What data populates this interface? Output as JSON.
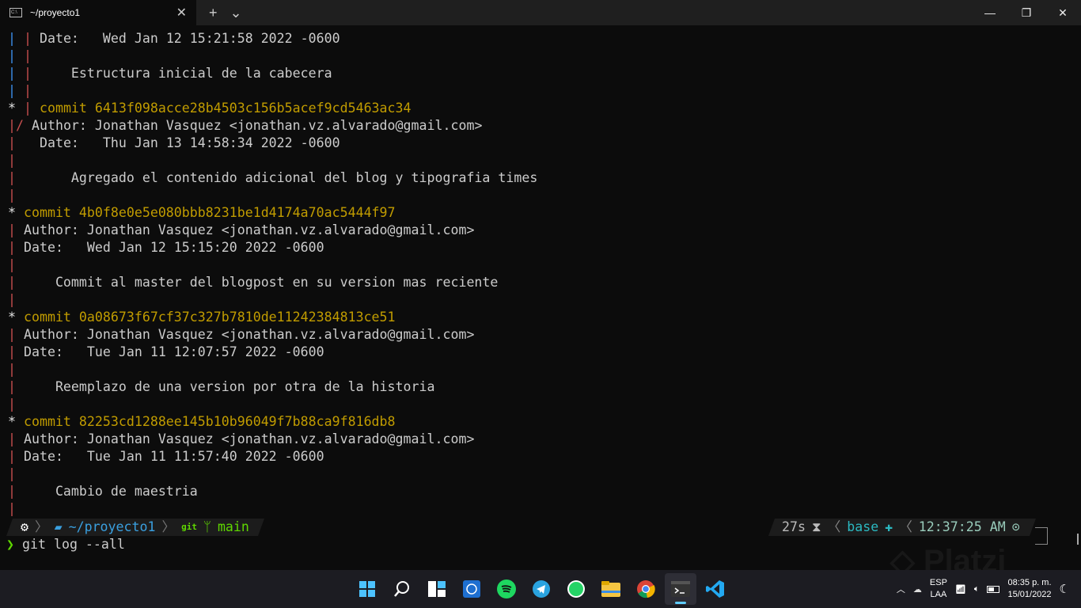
{
  "window": {
    "tab_title": "~/proyecto1",
    "new_tab": "+",
    "dropdown": "⌄",
    "minimize": "—",
    "maximize": "❐",
    "close": "✕",
    "tab_close": "✕"
  },
  "colors": {
    "blue": "#3b8eea",
    "red": "#c74e4e",
    "yellow": "#c19c00",
    "prompt_path": "#3aa0e0",
    "git": "#5fd700",
    "base": "#2bb8c0"
  },
  "terminal": {
    "rows": [
      [
        {
          "t": "| ",
          "c": "blue"
        },
        {
          "t": "| ",
          "c": "red"
        },
        {
          "t": "Date:   Wed Jan 12 15:21:58 2022 -0600",
          "c": "text"
        }
      ],
      [
        {
          "t": "| ",
          "c": "blue"
        },
        {
          "t": "|",
          "c": "red"
        }
      ],
      [
        {
          "t": "| ",
          "c": "blue"
        },
        {
          "t": "| ",
          "c": "red"
        },
        {
          "t": "    Estructura inicial de la cabecera",
          "c": "text"
        }
      ],
      [
        {
          "t": "| ",
          "c": "blue"
        },
        {
          "t": "|",
          "c": "red"
        }
      ],
      [
        {
          "t": "* ",
          "c": "white"
        },
        {
          "t": "| ",
          "c": "red"
        },
        {
          "t": "commit 6413f098acce28b4503c156b5acef9cd5463ac34",
          "c": "yellow"
        }
      ],
      [
        {
          "t": "|/ ",
          "c": "red"
        },
        {
          "t": "Author: Jonathan Vasquez <jonathan.vz.alvarado@gmail.com>",
          "c": "text"
        }
      ],
      [
        {
          "t": "|   ",
          "c": "red"
        },
        {
          "t": "Date:   Thu Jan 13 14:58:34 2022 -0600",
          "c": "text"
        }
      ],
      [
        {
          "t": "|",
          "c": "red"
        }
      ],
      [
        {
          "t": "|   ",
          "c": "red"
        },
        {
          "t": "    Agregado el contenido adicional del blog y tipografia times",
          "c": "text"
        }
      ],
      [
        {
          "t": "|",
          "c": "red"
        }
      ],
      [
        {
          "t": "* ",
          "c": "white"
        },
        {
          "t": "commit 4b0f8e0e5e080bbb8231be1d4174a70ac5444f97",
          "c": "yellow"
        }
      ],
      [
        {
          "t": "| ",
          "c": "red"
        },
        {
          "t": "Author: Jonathan Vasquez <jonathan.vz.alvarado@gmail.com>",
          "c": "text"
        }
      ],
      [
        {
          "t": "| ",
          "c": "red"
        },
        {
          "t": "Date:   Wed Jan 12 15:15:20 2022 -0600",
          "c": "text"
        }
      ],
      [
        {
          "t": "|",
          "c": "red"
        }
      ],
      [
        {
          "t": "| ",
          "c": "red"
        },
        {
          "t": "    Commit al master del blogpost en su version mas reciente",
          "c": "text"
        }
      ],
      [
        {
          "t": "|",
          "c": "red"
        }
      ],
      [
        {
          "t": "* ",
          "c": "white"
        },
        {
          "t": "commit 0a08673f67cf37c327b7810de11242384813ce51",
          "c": "yellow"
        }
      ],
      [
        {
          "t": "| ",
          "c": "red"
        },
        {
          "t": "Author: Jonathan Vasquez <jonathan.vz.alvarado@gmail.com>",
          "c": "text"
        }
      ],
      [
        {
          "t": "| ",
          "c": "red"
        },
        {
          "t": "Date:   Tue Jan 11 12:07:57 2022 -0600",
          "c": "text"
        }
      ],
      [
        {
          "t": "|",
          "c": "red"
        }
      ],
      [
        {
          "t": "| ",
          "c": "red"
        },
        {
          "t": "    Reemplazo de una version por otra de la historia",
          "c": "text"
        }
      ],
      [
        {
          "t": "|",
          "c": "red"
        }
      ],
      [
        {
          "t": "* ",
          "c": "white"
        },
        {
          "t": "commit 82253cd1288ee145b10b96049f7b88ca9f816db8",
          "c": "yellow"
        }
      ],
      [
        {
          "t": "| ",
          "c": "red"
        },
        {
          "t": "Author: Jonathan Vasquez <jonathan.vz.alvarado@gmail.com>",
          "c": "text"
        }
      ],
      [
        {
          "t": "| ",
          "c": "red"
        },
        {
          "t": "Date:   Tue Jan 11 11:57:40 2022 -0600",
          "c": "text"
        }
      ],
      [
        {
          "t": "|",
          "c": "red"
        }
      ],
      [
        {
          "t": "| ",
          "c": "red"
        },
        {
          "t": "    Cambio de maestria",
          "c": "text"
        }
      ],
      [
        {
          "t": "|",
          "c": "red"
        }
      ]
    ]
  },
  "prompt": {
    "os_icon": "linux-icon",
    "path": "~/proyecto1",
    "git_label": "git",
    "branch": "main",
    "duration": "27s",
    "env": "base",
    "time": "12:37:25 AM"
  },
  "command": {
    "arrow": "❯",
    "text": "git log --all"
  },
  "taskbar": {
    "apps": [
      "windows-start",
      "search",
      "widgets",
      "app",
      "spotify",
      "telegram",
      "whatsapp",
      "file-explorer",
      "chrome",
      "terminal",
      "vscode"
    ],
    "lang_top": "ESP",
    "lang_bottom": "LAA",
    "time": "08:35 p. m.",
    "date": "15/01/2022"
  },
  "watermark": "Platzi"
}
